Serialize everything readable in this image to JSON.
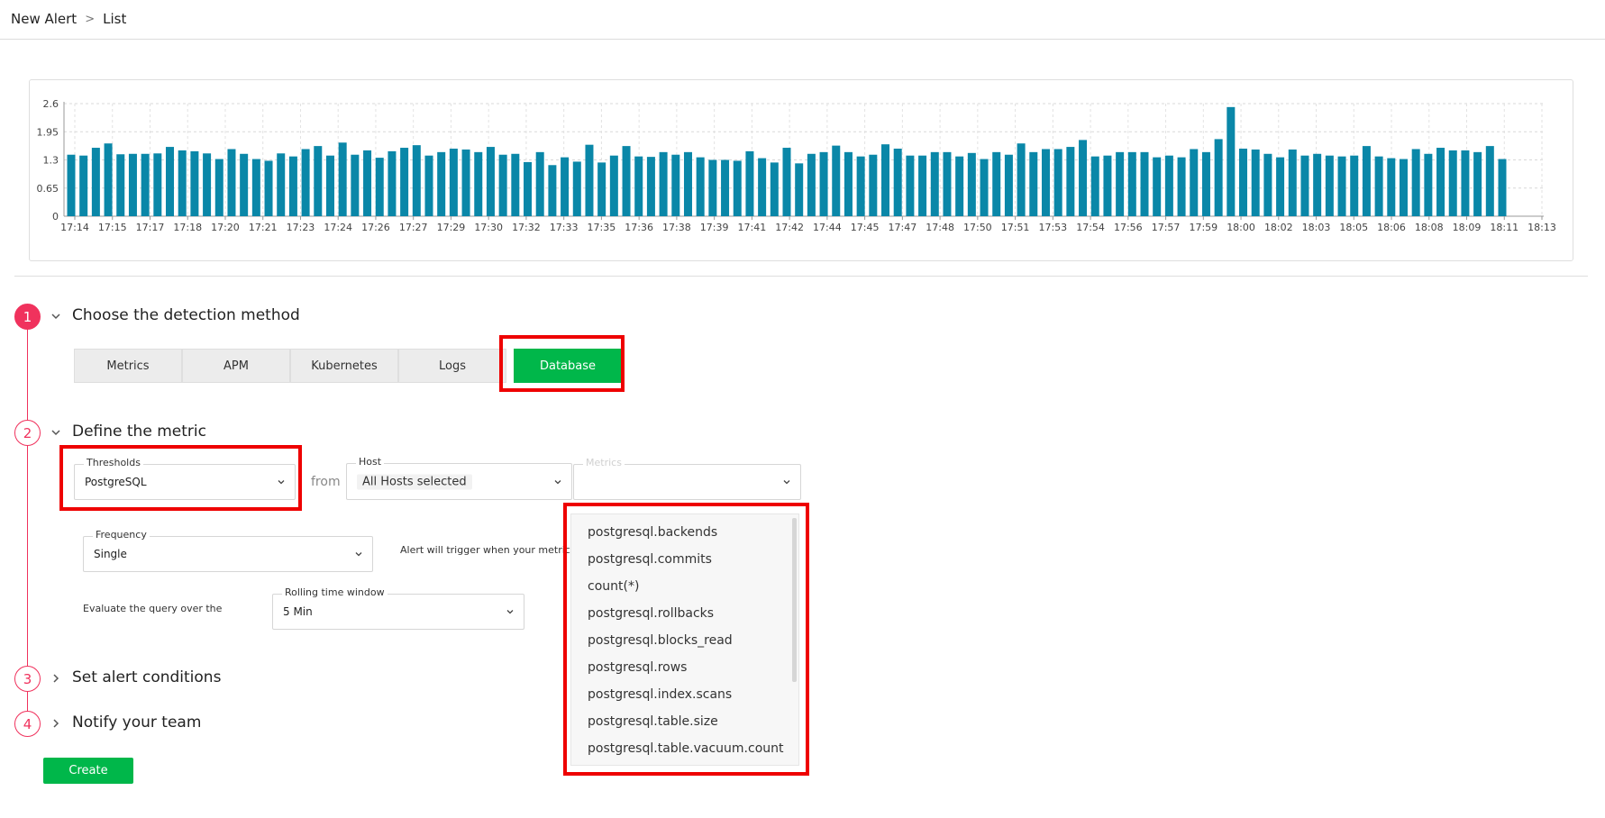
{
  "breadcrumb": {
    "parent": "New Alert",
    "separator": ">",
    "current": "List"
  },
  "chart_data": {
    "type": "bar",
    "title": "",
    "xlabel": "",
    "ylabel": "",
    "ylim": [
      0,
      2.6
    ],
    "yticks": [
      "0",
      "0.65",
      "1.3",
      "1.95",
      "2.6"
    ],
    "xticks": [
      "17:14",
      "17:15",
      "17:17",
      "17:18",
      "17:20",
      "17:21",
      "17:23",
      "17:24",
      "17:26",
      "17:27",
      "17:29",
      "17:30",
      "17:32",
      "17:33",
      "17:35",
      "17:36",
      "17:38",
      "17:39",
      "17:41",
      "17:42",
      "17:44",
      "17:45",
      "17:47",
      "17:48",
      "17:50",
      "17:51",
      "17:53",
      "17:54",
      "17:56",
      "17:57",
      "17:59",
      "18:00",
      "18:02",
      "18:03",
      "18:05",
      "18:06",
      "18:08",
      "18:09",
      "18:11",
      "18:13"
    ],
    "grid": true,
    "color": "#0a87a8",
    "values": [
      1.42,
      1.4,
      1.58,
      1.68,
      1.43,
      1.44,
      1.44,
      1.45,
      1.6,
      1.52,
      1.5,
      1.45,
      1.32,
      1.55,
      1.44,
      1.32,
      1.28,
      1.45,
      1.38,
      1.55,
      1.62,
      1.4,
      1.7,
      1.42,
      1.52,
      1.35,
      1.5,
      1.58,
      1.64,
      1.4,
      1.48,
      1.56,
      1.54,
      1.48,
      1.6,
      1.42,
      1.44,
      1.25,
      1.48,
      1.18,
      1.36,
      1.26,
      1.65,
      1.24,
      1.4,
      1.62,
      1.38,
      1.37,
      1.48,
      1.42,
      1.48,
      1.36,
      1.3,
      1.3,
      1.28,
      1.5,
      1.34,
      1.24,
      1.58,
      1.22,
      1.44,
      1.48,
      1.63,
      1.48,
      1.38,
      1.42,
      1.66,
      1.56,
      1.4,
      1.4,
      1.48,
      1.48,
      1.38,
      1.46,
      1.32,
      1.48,
      1.42,
      1.68,
      1.48,
      1.55,
      1.55,
      1.6,
      1.76,
      1.38,
      1.4,
      1.48,
      1.48,
      1.48,
      1.36,
      1.4,
      1.36,
      1.55,
      1.48,
      1.78,
      2.52,
      1.56,
      1.54,
      1.44,
      1.36,
      1.54,
      1.4,
      1.44,
      1.4,
      1.38,
      1.4,
      1.62,
      1.38,
      1.34,
      1.32,
      1.55,
      1.44,
      1.58,
      1.52,
      1.52,
      1.48,
      1.62,
      1.32
    ]
  },
  "steps": [
    {
      "number": "1",
      "title": "Choose the detection method",
      "expanded": true
    },
    {
      "number": "2",
      "title": "Define the metric",
      "expanded": true
    },
    {
      "number": "3",
      "title": "Set alert conditions",
      "expanded": false
    },
    {
      "number": "4",
      "title": "Notify your team",
      "expanded": false
    }
  ],
  "methods": [
    "Metrics",
    "APM",
    "Kubernetes",
    "Logs",
    "Database"
  ],
  "selected_method": "Database",
  "metric": {
    "thresholds_label": "Thresholds",
    "thresholds_value": "PostgreSQL",
    "from_text": "from",
    "host_label": "Host",
    "host_value": "All Hosts selected",
    "metrics_label": "Metrics",
    "metrics_value": "",
    "frequency_label": "Frequency",
    "frequency_value": "Single",
    "trigger_text": "Alert will trigger when your metric va",
    "evaluate_text": "Evaluate the query over the",
    "window_label": "Rolling time window",
    "window_value": "5 Min"
  },
  "metrics_options": [
    "postgresql.backends",
    "postgresql.commits",
    "count(*)",
    "postgresql.rollbacks",
    "postgresql.blocks_read",
    "postgresql.rows",
    "postgresql.index.scans",
    "postgresql.table.size",
    "postgresql.table.vacuum.count"
  ],
  "create_label": "Create",
  "colors": {
    "accent": "#f0325d",
    "primary": "#00b74a",
    "highlight": "#ee0000",
    "bar": "#0a87a8"
  }
}
